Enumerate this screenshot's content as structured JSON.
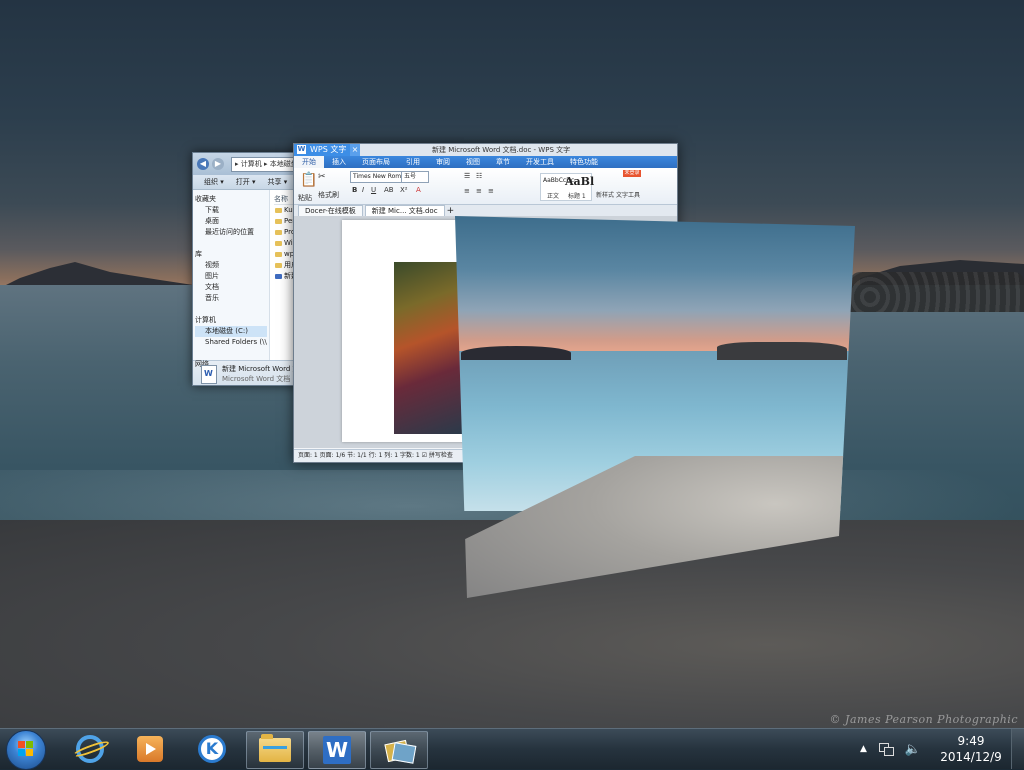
{
  "desktop": {
    "watermark": "© James Pearson Photographic"
  },
  "explorer": {
    "address": "▸ 计算机 ▸ 本地磁盘 (C:) ▸",
    "toolbar": [
      "组织 ▾",
      "打开 ▾",
      "共享 ▾"
    ],
    "nav": [
      {
        "label": "收藏夹",
        "indent": false
      },
      {
        "label": "下载",
        "indent": true
      },
      {
        "label": "桌面",
        "indent": true
      },
      {
        "label": "最近访问的位置",
        "indent": true
      },
      {
        "label": "",
        "indent": false
      },
      {
        "label": "库",
        "indent": false
      },
      {
        "label": "视频",
        "indent": true
      },
      {
        "label": "图片",
        "indent": true
      },
      {
        "label": "文档",
        "indent": true
      },
      {
        "label": "音乐",
        "indent": true
      },
      {
        "label": "",
        "indent": false
      },
      {
        "label": "计算机",
        "indent": false
      },
      {
        "label": "本地磁盘 (C:)",
        "indent": true,
        "selected": true
      },
      {
        "label": "Shared Folders (\\\\",
        "indent": true
      },
      {
        "label": "",
        "indent": false
      },
      {
        "label": "网络",
        "indent": false
      }
    ],
    "files_header": "名称",
    "files": [
      {
        "name": "KuGou",
        "type": "folder"
      },
      {
        "name": "PerfLogs",
        "type": "folder"
      },
      {
        "name": "Program Files",
        "type": "folder"
      },
      {
        "name": "Windows",
        "type": "folder"
      },
      {
        "name": "wps",
        "type": "folder"
      },
      {
        "name": "用户",
        "type": "folder"
      },
      {
        "name": "新建 Microsoft Word",
        "type": "doc"
      }
    ],
    "status_name": "新建 Microsoft Word 文档",
    "status_type": "Microsoft Word 文档"
  },
  "wps": {
    "app_tab": "WPS 文字",
    "doc_title": "新建 Microsoft Word 文档.doc - WPS 文字",
    "menus": [
      "开始",
      "插入",
      "页面布局",
      "引用",
      "审阅",
      "视图",
      "章节",
      "开发工具",
      "特色功能"
    ],
    "login": "未登录",
    "ribbon": {
      "paste": "粘贴",
      "format_painter": "格式刷",
      "font": "Times New Roma",
      "size": "五号",
      "style_sample_small": "AaBbCcDc",
      "style_sample_big": "AaBl",
      "style_label_body": "正文",
      "style_label_h1": "标题 1",
      "new_style": "新样式",
      "text_tools": "文字工具"
    },
    "doc_tabs": [
      "Docer-在线模板",
      "新建 Mic... 文档.doc"
    ],
    "status": "页面: 1   页面: 1/6   节: 1/1   行: 1   列: 1   字数: 1   ☑ 拼写检查"
  },
  "taskbar": {
    "items": [
      {
        "name": "internet-explorer",
        "icon": "ie-icon",
        "open": false
      },
      {
        "name": "media-player",
        "icon": "media-icon",
        "open": false
      },
      {
        "name": "k-app",
        "icon": "k-icon",
        "open": false
      },
      {
        "name": "windows-explorer",
        "icon": "folder-icon",
        "open": true
      },
      {
        "name": "wps-writer",
        "icon": "wps-icon",
        "open": true,
        "active": true
      },
      {
        "name": "photo-viewer",
        "icon": "photo-icon",
        "open": true
      }
    ],
    "time": "9:49",
    "date": "2014/12/9"
  }
}
